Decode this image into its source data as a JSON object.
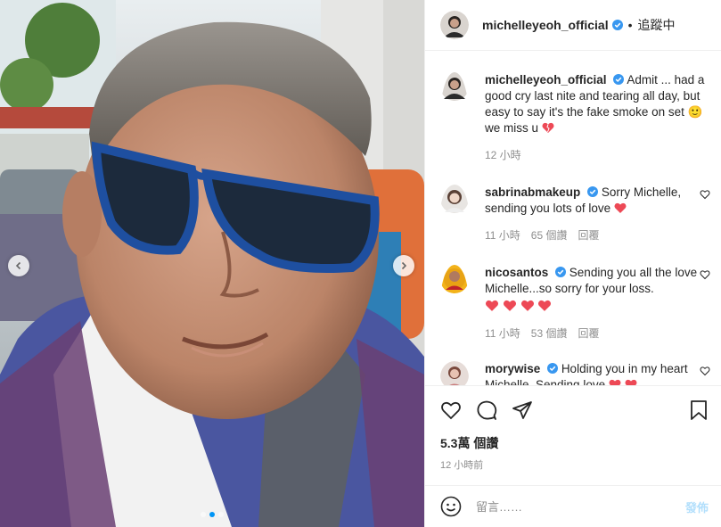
{
  "post": {
    "author": "michelleyeoh_official",
    "follow_status": "追蹤中",
    "separator": "•",
    "caption_user": "michelleyeoh_official",
    "caption_text": "Admit ... had a good cry last nite and tearing all day, but easy to say it's the fake smoke on set 🙂 we miss u",
    "caption_time": "12 小時",
    "views": "5.3萬 個讚",
    "posted": "12 小時前"
  },
  "comments": [
    {
      "user": "sabrinabmakeup",
      "text": "Sorry Michelle, sending you lots of love",
      "time": "11 小時",
      "likes": "65 個讚",
      "reply": "回覆"
    },
    {
      "user": "nicosantos",
      "text": "Sending you all the love Michelle...so sorry for your loss.",
      "time": "11 小時",
      "likes": "53 個讚",
      "reply": "回覆"
    },
    {
      "user": "morywise",
      "text": "Holding you in my heart Michelle. Sending love"
    }
  ],
  "composer": {
    "placeholder": "留言……",
    "post_label": "發佈"
  },
  "carousel": {
    "current": 2,
    "count": 3
  },
  "icons": {
    "verified": "verified-badge-icon",
    "like": "heart-outline-icon",
    "comment": "speech-bubble-icon",
    "share": "paper-plane-icon",
    "save": "bookmark-icon",
    "emoji": "smiley-icon",
    "prev": "chevron-left-icon",
    "next": "chevron-right-icon"
  },
  "colors": {
    "verified": "#3897f0",
    "heart": "#ed4956",
    "link_disabled": "#b2dffc"
  }
}
